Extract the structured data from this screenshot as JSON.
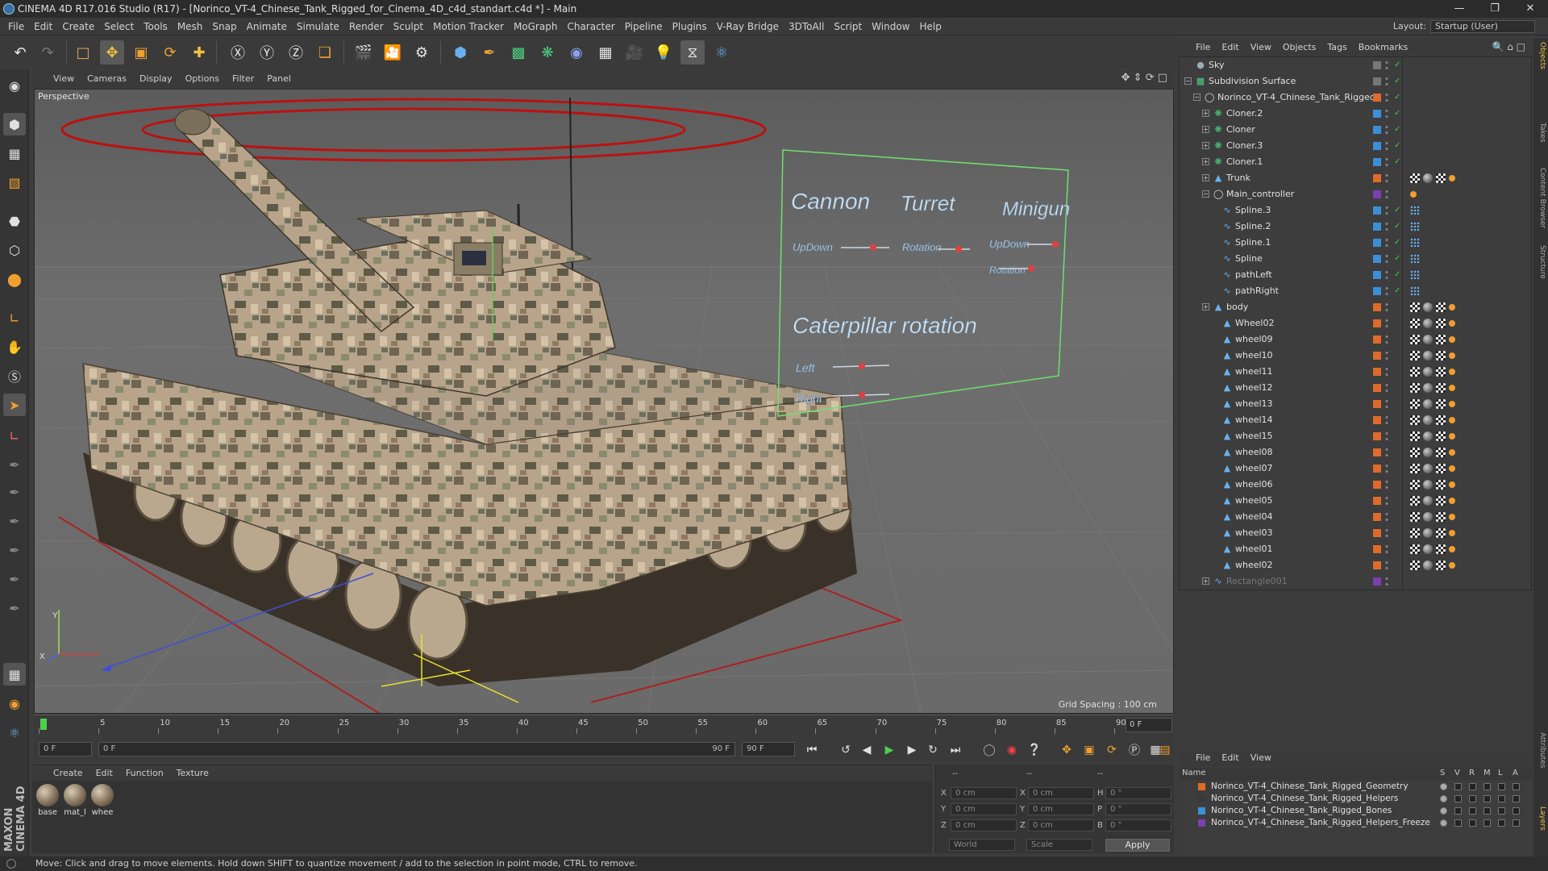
{
  "window": {
    "title": "CINEMA 4D R17.016 Studio (R17) - [Norinco_VT-4_Chinese_Tank_Rigged_for_Cinema_4D_c4d_standart.c4d *] - Main"
  },
  "menu": [
    "File",
    "Edit",
    "Create",
    "Select",
    "Tools",
    "Mesh",
    "Snap",
    "Animate",
    "Simulate",
    "Render",
    "Sculpt",
    "Motion Tracker",
    "MoGraph",
    "Character",
    "Pipeline",
    "Plugins",
    "V-Ray Bridge",
    "3DToAll",
    "Script",
    "Window",
    "Help"
  ],
  "layout": {
    "label": "Layout:",
    "value": "Startup (User)"
  },
  "viewport": {
    "menu": [
      "View",
      "Cameras",
      "Display",
      "Options",
      "Filter",
      "Panel"
    ],
    "label": "Perspective",
    "grid_spacing": "Grid Spacing : 100 cm",
    "hud": {
      "cannon": "Cannon",
      "turret": "Turret",
      "minigun": "Minigun",
      "updown1": "UpDown",
      "rotation1": "Rotation",
      "updown2": "UpDown",
      "rotation2": "Rotation",
      "caterpillar": "Caterpillar rotation",
      "left": "Left",
      "right": "Right"
    },
    "axis_y": "Y",
    "axis_x": "X"
  },
  "timeline": {
    "ticks": [
      "0",
      "5",
      "10",
      "15",
      "20",
      "25",
      "30",
      "35",
      "40",
      "45",
      "50",
      "55",
      "60",
      "65",
      "70",
      "75",
      "80",
      "85",
      "90"
    ],
    "current": "0 F"
  },
  "transport": {
    "start": "0 F",
    "range_start": "0 F",
    "range_end": "90 F",
    "end": "90 F"
  },
  "materials": {
    "menu": [
      "Create",
      "Edit",
      "Function",
      "Texture"
    ],
    "items": [
      "base",
      "mat_l",
      "whee"
    ]
  },
  "coords": {
    "x_pos": "0 cm",
    "y_pos": "0 cm",
    "z_pos": "0 cm",
    "x_size": "0 cm",
    "y_size": "0 cm",
    "z_size": "0 cm",
    "h": "0 °",
    "p": "0 °",
    "b": "0 °",
    "labels": {
      "x": "X",
      "y": "Y",
      "z": "Z",
      "h": "H",
      "p": "P",
      "b": "B"
    },
    "col_header_1": "--",
    "col_header_2": "--",
    "col_header_3": "--",
    "mode": "World",
    "scale": "Scale",
    "apply": "Apply"
  },
  "object_manager": {
    "menu": [
      "File",
      "Edit",
      "View",
      "Objects",
      "Tags",
      "Bookmarks"
    ],
    "objects": [
      {
        "name": "Sky",
        "indent": 0,
        "color": "#777777",
        "icon": "sky-icon"
      },
      {
        "name": "Subdivision Surface",
        "indent": 0,
        "color": "#777777",
        "icon": "subdivision-icon"
      },
      {
        "name": "Norinco_VT-4_Chinese_Tank_Rigged",
        "indent": 1,
        "color": "#e06a2a",
        "icon": "null-icon"
      },
      {
        "name": "Cloner.2",
        "indent": 2,
        "color": "#3b8fd6",
        "icon": "cloner-icon"
      },
      {
        "name": "Cloner",
        "indent": 2,
        "color": "#3b8fd6",
        "icon": "cloner-icon"
      },
      {
        "name": "Cloner.3",
        "indent": 2,
        "color": "#3b8fd6",
        "icon": "cloner-icon"
      },
      {
        "name": "Cloner.1",
        "indent": 2,
        "color": "#3b8fd6",
        "icon": "cloner-icon"
      },
      {
        "name": "Trunk",
        "indent": 2,
        "color": "#e06a2a",
        "icon": "polygon-icon"
      },
      {
        "name": "Main_controller",
        "indent": 2,
        "color": "#7d3fb0",
        "icon": "null-icon"
      },
      {
        "name": "Spline.3",
        "indent": 3,
        "color": "#3b8fd6",
        "icon": "spline-icon"
      },
      {
        "name": "Spline.2",
        "indent": 3,
        "color": "#3b8fd6",
        "icon": "spline-icon"
      },
      {
        "name": "Spline.1",
        "indent": 3,
        "color": "#3b8fd6",
        "icon": "spline-icon"
      },
      {
        "name": "Spline",
        "indent": 3,
        "color": "#3b8fd6",
        "icon": "spline-icon"
      },
      {
        "name": "pathLeft",
        "indent": 3,
        "color": "#3b8fd6",
        "icon": "spline-icon"
      },
      {
        "name": "pathRight",
        "indent": 3,
        "color": "#3b8fd6",
        "icon": "spline-icon"
      },
      {
        "name": "body",
        "indent": 2,
        "color": "#e06a2a",
        "icon": "polygon-icon"
      },
      {
        "name": "Wheel02",
        "indent": 3,
        "color": "#e06a2a",
        "icon": "polygon-icon"
      },
      {
        "name": "wheel09",
        "indent": 3,
        "color": "#e06a2a",
        "icon": "polygon-icon"
      },
      {
        "name": "wheel10",
        "indent": 3,
        "color": "#e06a2a",
        "icon": "polygon-icon"
      },
      {
        "name": "wheel11",
        "indent": 3,
        "color": "#e06a2a",
        "icon": "polygon-icon"
      },
      {
        "name": "wheel12",
        "indent": 3,
        "color": "#e06a2a",
        "icon": "polygon-icon"
      },
      {
        "name": "wheel13",
        "indent": 3,
        "color": "#e06a2a",
        "icon": "polygon-icon"
      },
      {
        "name": "wheel14",
        "indent": 3,
        "color": "#e06a2a",
        "icon": "polygon-icon"
      },
      {
        "name": "wheel15",
        "indent": 3,
        "color": "#e06a2a",
        "icon": "polygon-icon"
      },
      {
        "name": "wheel08",
        "indent": 3,
        "color": "#e06a2a",
        "icon": "polygon-icon"
      },
      {
        "name": "wheel07",
        "indent": 3,
        "color": "#e06a2a",
        "icon": "polygon-icon"
      },
      {
        "name": "wheel06",
        "indent": 3,
        "color": "#e06a2a",
        "icon": "polygon-icon"
      },
      {
        "name": "wheel05",
        "indent": 3,
        "color": "#e06a2a",
        "icon": "polygon-icon"
      },
      {
        "name": "wheel04",
        "indent": 3,
        "color": "#e06a2a",
        "icon": "polygon-icon"
      },
      {
        "name": "wheel03",
        "indent": 3,
        "color": "#e06a2a",
        "icon": "polygon-icon"
      },
      {
        "name": "wheel01",
        "indent": 3,
        "color": "#e06a2a",
        "icon": "polygon-icon"
      },
      {
        "name": "wheel02",
        "indent": 3,
        "color": "#e06a2a",
        "icon": "polygon-icon"
      },
      {
        "name": "Rectangle001",
        "indent": 2,
        "color": "#7d3fb0",
        "icon": "spline-icon",
        "dim": true
      }
    ]
  },
  "layer_manager": {
    "menu": [
      "File",
      "Edit",
      "View"
    ],
    "header": {
      "name": "Name",
      "cols": [
        "S",
        "V",
        "R",
        "M",
        "L",
        "A"
      ]
    },
    "layers": [
      {
        "name": "Norinco_VT-4_Chinese_Tank_Rigged_Geometry",
        "color": "#e06a2a"
      },
      {
        "name": "Norinco_VT-4_Chinese_Tank_Rigged_Helpers",
        "color": "#3a3a3a"
      },
      {
        "name": "Norinco_VT-4_Chinese_Tank_Rigged_Bones",
        "color": "#3b8fd6"
      },
      {
        "name": "Norinco_VT-4_Chinese_Tank_Rigged_Helpers_Freeze",
        "color": "#7d3fb0"
      }
    ]
  },
  "right_tabs": [
    "Objects",
    "Takes",
    "Content Browser",
    "Structure",
    "Attributes",
    "Layers"
  ],
  "status": "Move: Click and drag to move elements. Hold down SHIFT to quantize movement / add to the selection in point mode, CTRL to remove.",
  "brand": "MAXON CINEMA 4D"
}
